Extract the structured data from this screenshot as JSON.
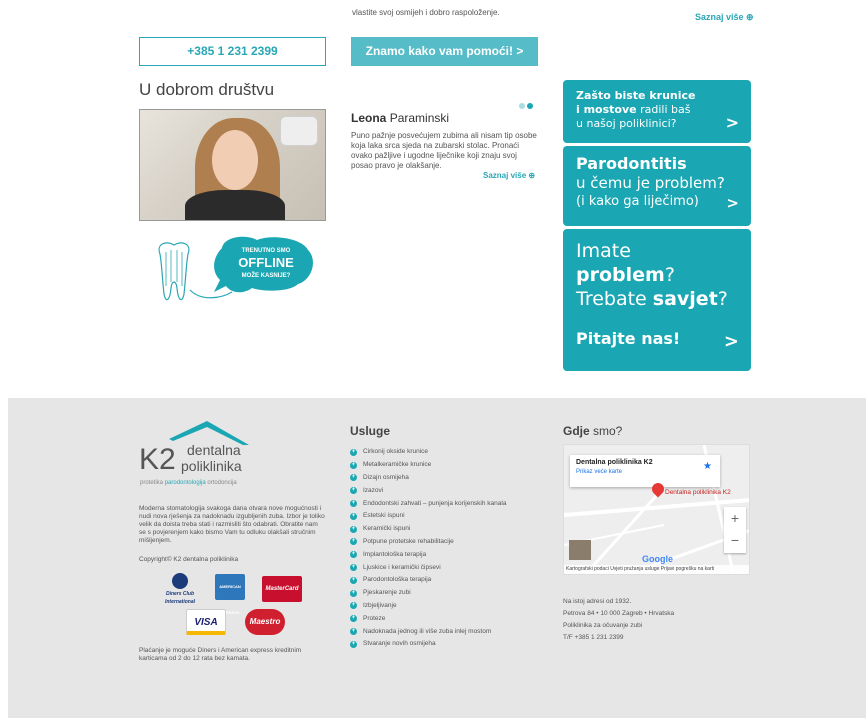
{
  "top": {
    "text": "vlastite svoj osmijeh i dobro raspoloženje.",
    "more": "Saznaj više"
  },
  "contact": {
    "phone": "+385 1 231 2399",
    "help_button": "Znamo kako vam pomoći! >"
  },
  "section": {
    "title": "U dobrom društvu"
  },
  "testimonial": {
    "first_name": "Leona",
    "last_name": "Paraminski",
    "text": "Puno pažnje posvećujem zubima ali nisam tip osobe koja laka srca sjeda na zubarski stolac. Pronaći ovako pažljive i ugodne liječnike koji znaju svoj posao pravo je olakšanje.",
    "more": "Saznaj više"
  },
  "offline_bubble": {
    "line1": "TRENUTNO SMO",
    "line2": "OFFLINE",
    "line3": "MOŽE KASNIJE?"
  },
  "promo": {
    "p1": {
      "line1": "Zašto biste krunice",
      "line2_bold": "i mostove",
      "line2_rest": " radili baš",
      "line3": "u našoj poliklinici?"
    },
    "p2": {
      "title": "Parodontitis",
      "line2": "u čemu je problem?",
      "line3": "(i kako ga liječimo)"
    },
    "p3": {
      "w1": "Imate",
      "w2": "problem",
      "w3": "?",
      "w4": "Trebate ",
      "w5": "savjet",
      "w6": "?",
      "cta": "Pitajte nas!"
    }
  },
  "footer": {
    "logo_k2": "K2",
    "logo_line1": "dentalna",
    "logo_line2": "poliklinika",
    "logo_sub_1": "protetika ",
    "logo_sub_2": "parodontologija",
    "logo_sub_3": " ortodoncija",
    "about": "Moderna stomatologija svakoga dana otvara nove mogućnosti i nudi nova rješenja za nadoknadu izgubljenih zuba. Izbor je toliko velik da doista treba stati i razmisliti što odabrati. Obratite nam se s povjerenjem kako bismo Vam tu odluku olakšali stručnim mišljenjem.",
    "copyright": "Copyright© K2 dentalna poliklinika",
    "cards": [
      "Diners Club International",
      "AMERICAN EXPRESS",
      "MasterCard",
      "VISA",
      "Maestro"
    ],
    "payment_note": "Plaćanje je moguće Diners i American express kreditnim karticama od 2 do 12 rata bez kamata.",
    "services_title": "Usluge",
    "services": [
      "Cirkonij okside krunice",
      "Metalkeramičke krunice",
      "Dizajn osmijeha",
      "Izazovi",
      "Endodontski zahvati – punjenja korijenskih kanala",
      "Estetski ispuni",
      "Keramički ispuni",
      "Potpune protetske rehabilitacije",
      "Implantološka terapija",
      "Ljuskice i keramički čipsevi",
      "Parodontološka terapija",
      "Pjeskarenje zubi",
      "Izbjeljivanje",
      "Proteze",
      "Nadoknada jednog ili više zuba inlej mostom",
      "Stvaranje novih osmijeha"
    ],
    "where_title_1": "Gdje",
    "where_title_2": " smo?",
    "map": {
      "popup_title": "Dentalna poliklinika K2",
      "popup_link": "Prikaz veće karte",
      "place_label": "Dentalna poliklinika K2",
      "footer_text": "Kartografski podaci   Uvjeti pružanja usluge   Prijavi pogrešku na karti"
    },
    "address": [
      "Na istoj adresi od 1932.",
      "Petrova 84 • 10 000 Zagreb • Hrvatska",
      "Poliklinika za očuvanje zubi",
      "T/F +385 1 231 2399"
    ]
  }
}
